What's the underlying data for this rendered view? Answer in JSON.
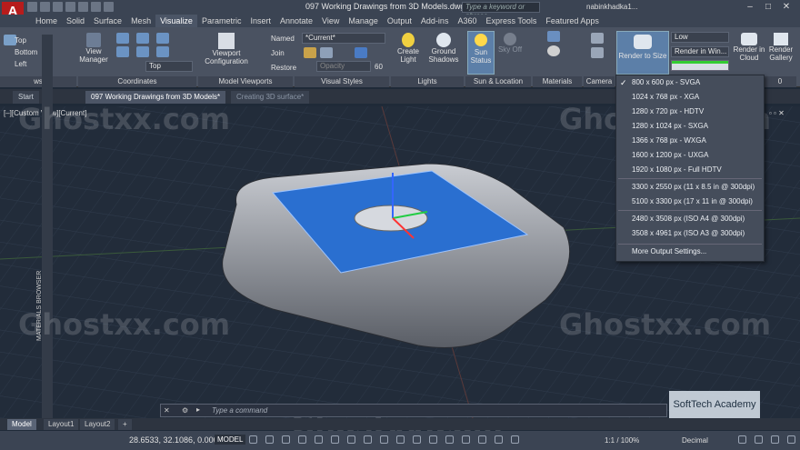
{
  "app": {
    "title": "097 Working Drawings from 3D Models.dwg",
    "search_placeholder": "Type a keyword or phrase",
    "user": "nabinkhadka1...",
    "logo_letter": "A"
  },
  "ribbon_tabs": [
    "Home",
    "Solid",
    "Surface",
    "Mesh",
    "Visualize",
    "Parametric",
    "Insert",
    "Annotate",
    "View",
    "Manage",
    "Output",
    "Add-ins",
    "A360",
    "Express Tools",
    "Featured Apps"
  ],
  "active_ribbon_tab": "Visualize",
  "ribbon": {
    "views": {
      "items": [
        "Top",
        "Bottom",
        "Left"
      ],
      "title": "ws"
    },
    "view_manager": "View\nManager",
    "coordinates": {
      "title": "Coordinates",
      "top_dropdown": "Top"
    },
    "model_viewports": {
      "button": "Viewport\nConfiguration",
      "title": "Model Viewports"
    },
    "named": [
      "Named",
      "Join",
      "Restore"
    ],
    "visual_styles": {
      "current": "*Current*",
      "opacity_label": "Opacity",
      "opacity_value": "60",
      "title": "Visual Styles"
    },
    "lights": {
      "create": "Create\nLight",
      "ground": "Ground\nShadows",
      "title": "Lights"
    },
    "sun": {
      "status": "Sun\nStatus",
      "sky": "Sky Off",
      "title": "Sun & Location"
    },
    "materials_title": "Materials",
    "camera_title": "Camera",
    "render": {
      "render_to_size": "Render to Size",
      "quality": "Low",
      "render_in": "Render in Win...",
      "cloud": "Render in\nCloud",
      "gallery": "Render\nGallery",
      "title_fragment": "0"
    }
  },
  "doc_tabs": [
    "Start",
    "097 Working Drawings from 3D Models*",
    "Creating 3D surface*"
  ],
  "viewport_label": "[–][Custom View][Current]",
  "render_sizes": [
    "800 x 600 px - SVGA",
    "1024 x 768 px - XGA",
    "1280 x 720 px - HDTV",
    "1280 x 1024 px - SXGA",
    "1366 x 768 px - WXGA",
    "1600 x 1200 px - UXGA",
    "1920 x 1080 px - Full HDTV",
    "3300 x 2550 px (11 x 8.5 in @ 300dpi)",
    "5100 x 3300 px (17 x 11 in @ 300dpi)",
    "2480 x 3508 px (ISO A4 @ 300dpi)",
    "3508 x 4961 px (ISO A3 @ 300dpi)",
    "More Output Settings..."
  ],
  "selected_render_size": "800 x 600 px - SVGA",
  "command_placeholder": "Type a command",
  "layout_tabs": [
    "Model",
    "Layout1",
    "Layout2"
  ],
  "status": {
    "coords": "28.6533, 32.1086, 0.0000",
    "model": "MODEL",
    "scale": "1:1 / 100%",
    "units": "Decimal"
  },
  "watermark": "Ghostxx.com",
  "brand": "SoftTech Academy",
  "materials_browser": "MATERIALS BROWSER"
}
